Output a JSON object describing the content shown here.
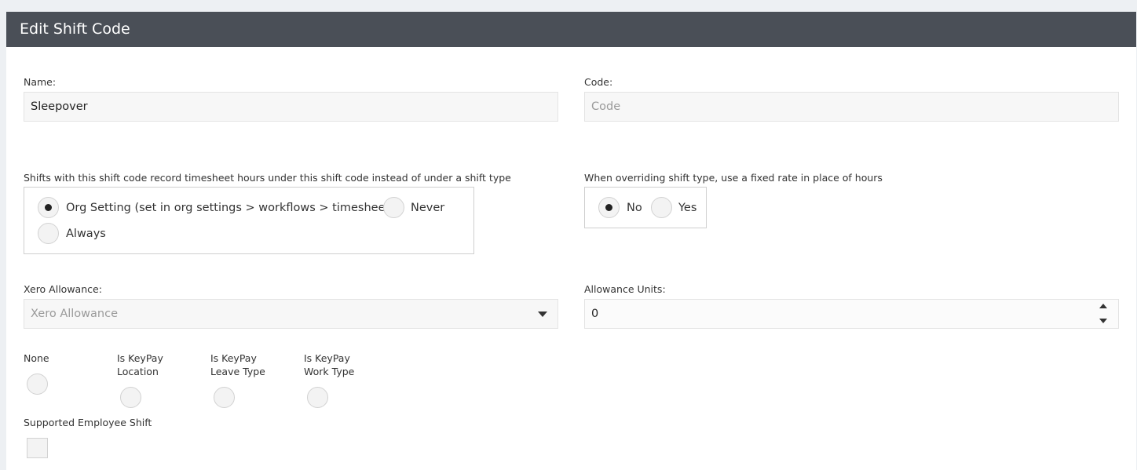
{
  "header": {
    "title": "Edit Shift Code"
  },
  "name": {
    "label": "Name:",
    "value": "Sleepover"
  },
  "code": {
    "label": "Code:",
    "placeholder": "Code"
  },
  "record_hours": {
    "label": "Shifts with this shift code record timesheet hours under this shift code instead of under a shift type",
    "options": [
      {
        "label": "Org Setting (set in org settings > workflows > timesheets)",
        "selected": true
      },
      {
        "label": "Never",
        "selected": false
      },
      {
        "label": "Always",
        "selected": false
      }
    ]
  },
  "fixed_rate": {
    "label": "When overriding shift type, use a fixed rate in place of hours",
    "options": [
      {
        "label": "No",
        "selected": true
      },
      {
        "label": "Yes",
        "selected": false
      }
    ]
  },
  "xero_allowance": {
    "label": "Xero Allowance:",
    "placeholder": "Xero Allowance"
  },
  "allowance_units": {
    "label": "Allowance Units:",
    "value": "0"
  },
  "keypay_type": {
    "options": [
      {
        "line1": "None",
        "line2": ""
      },
      {
        "line1": "Is KeyPay",
        "line2": "Location"
      },
      {
        "line1": "Is KeyPay",
        "line2": "Leave Type"
      },
      {
        "line1": "Is KeyPay",
        "line2": "Work Type"
      }
    ]
  },
  "supported_employee": {
    "label": "Supported Employee Shift",
    "checked": false
  }
}
